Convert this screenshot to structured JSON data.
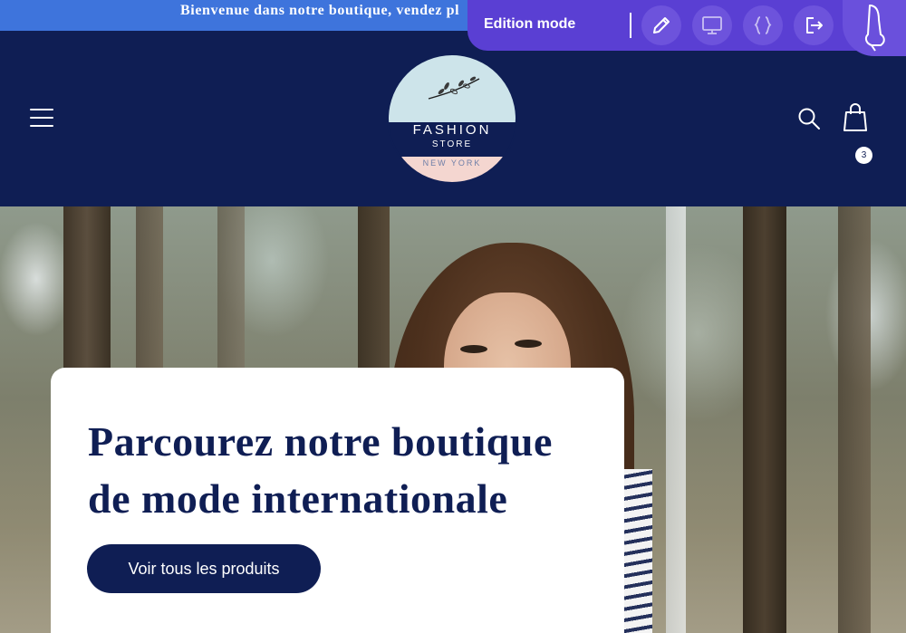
{
  "announcement": {
    "text": "Bienvenue dans notre boutique, vendez pl"
  },
  "header": {
    "logo": {
      "line1": "FASHION",
      "line2": "STORE",
      "line3": "NEW YORK"
    },
    "cart_count": "3",
    "icons": [
      "menu-icon",
      "search-icon",
      "cart-icon"
    ]
  },
  "hero": {
    "title": "Parcourez notre boutique de mode internationale",
    "button_label": "Voir tous les produits"
  },
  "editor_toolbar": {
    "label": "Edition mode",
    "icons": [
      "pencil-icon",
      "monitor-icon",
      "code-braces-icon",
      "logout-icon",
      "drag-handle-icon"
    ]
  },
  "colors": {
    "navy": "#0f1e54",
    "announce_blue": "#3e74dc",
    "toolbar_purple": "#5a3fd3",
    "logo_blue": "#cde4ea",
    "logo_pink": "#f4d6d0"
  }
}
